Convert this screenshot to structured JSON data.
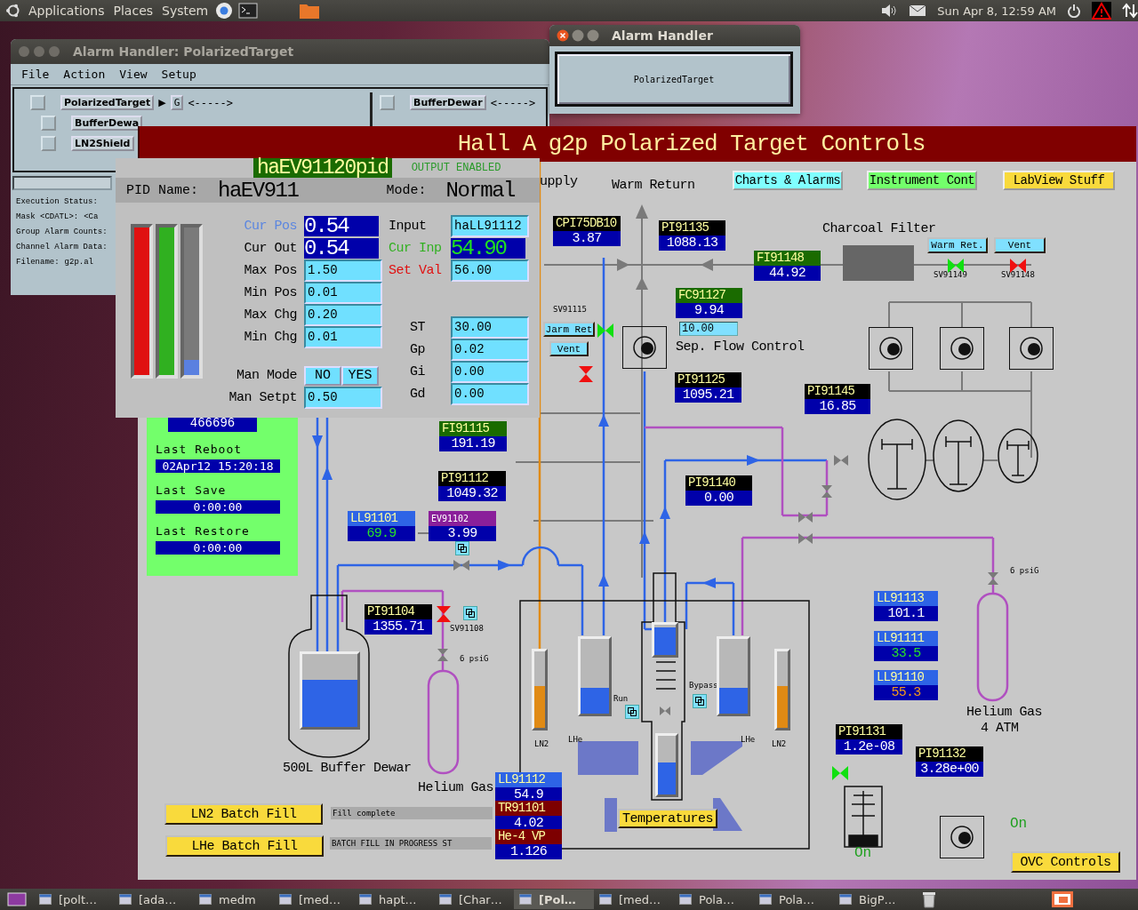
{
  "top_panel": {
    "menus": [
      "Applications",
      "Places",
      "System"
    ],
    "clock": "Sun Apr  8, 12:59 AM"
  },
  "alarm_window": {
    "title": "Alarm Handler: PolarizedTarget",
    "menus": [
      "File",
      "Action",
      "View",
      "Setup"
    ],
    "tree": {
      "label": "PolarizedTarget",
      "checked": false,
      "arrow": "▶",
      "group": "G",
      "count": "<----->",
      "children": [
        {
          "label": "BufferDewa",
          "checked": false
        },
        {
          "label": "LN2Shield",
          "checked": false
        }
      ]
    },
    "right_tree": [
      {
        "label": "BufferDewar",
        "checked": false,
        "count": "<----->"
      }
    ],
    "status": [
      {
        "label": "Execution Status:"
      },
      {
        "label": "Mask <CDATL>:",
        "value": "<Ca"
      },
      {
        "label": "Group Alarm Counts:"
      },
      {
        "label": "Channel Alarm Data:"
      },
      {
        "label": "Filename:",
        "value": "g2p.al"
      }
    ]
  },
  "small_alarm_window": {
    "title": "Alarm Handler",
    "button": "PolarizedTarget"
  },
  "main": {
    "title": "Hall A g2p Polarized Target Controls",
    "nav_buttons": [
      {
        "label": "Charts & Alarms",
        "color": "#80ffff"
      },
      {
        "label": "Instrument Cont",
        "color": "#73ff6b"
      },
      {
        "label": "LabView Stuff",
        "color": "#f9da3c"
      }
    ],
    "labels": [
      {
        "text": "upply"
      },
      {
        "text": "Warm Return"
      },
      {
        "text": "Charcoal Filter"
      },
      {
        "text": "Sep. Flow Control"
      },
      {
        "text": "500L Buffer Dewar"
      },
      {
        "text": "Helium Gas"
      },
      {
        "text": "Helium Gas"
      },
      {
        "text": "4 ATM"
      }
    ],
    "small_labels": [
      {
        "text": "SV91149"
      },
      {
        "text": "SV91148"
      },
      {
        "text": "SV91115"
      },
      {
        "text": "SV91108"
      },
      {
        "text": "6 psiG"
      },
      {
        "text": "6 psiG"
      },
      {
        "text": "LN2"
      },
      {
        "text": "LHe"
      },
      {
        "text": "LHe"
      },
      {
        "text": "LN2"
      },
      {
        "text": "Run"
      },
      {
        "text": "Bypass"
      }
    ],
    "readouts": [
      {
        "tag": "CPI75DB10",
        "value": "3.87",
        "color": "#000000",
        "in_range": false,
        "minor_alarm": false
      },
      {
        "tag": "PI91135",
        "value": "1088.13",
        "color": "#000000",
        "in_range": false,
        "minor_alarm": false
      },
      {
        "tag": "FI91148",
        "value": "44.92",
        "color": "#1a6b00",
        "in_range": false,
        "minor_alarm": false
      },
      {
        "tag": "FC91127",
        "value": "9.94",
        "color": "#1a6b00",
        "in_range": false,
        "minor_alarm": false
      },
      {
        "tag": "PI91125",
        "value": "1095.21",
        "color": "#000000",
        "in_range": false,
        "minor_alarm": false
      },
      {
        "tag": "PI91145",
        "value": "16.85",
        "color": "#000000",
        "in_range": false,
        "minor_alarm": false
      },
      {
        "tag": "FI91115",
        "value": "191.19",
        "color": "#1a6b00",
        "in_range": false,
        "minor_alarm": false
      },
      {
        "tag": "PI91112",
        "value": "1049.32",
        "color": "#000000",
        "in_range": false,
        "minor_alarm": false
      },
      {
        "tag": "PI91140",
        "value": "0.00",
        "color": "#000000",
        "in_range": false,
        "minor_alarm": false
      },
      {
        "tag": "LL91101",
        "value": "69.9",
        "color": "#2e64e6",
        "in_range": true,
        "minor_alarm": false
      },
      {
        "tag": "EV91102",
        "value": "3.99",
        "color": "#8a1f9a",
        "in_range": false,
        "minor_alarm": false
      },
      {
        "tag": "PI91104",
        "value": "1355.71",
        "color": "#000000",
        "in_range": false,
        "minor_alarm": false
      },
      {
        "tag": "LL91113",
        "value": "101.1",
        "color": "#2e64e6",
        "in_range": false,
        "minor_alarm": false
      },
      {
        "tag": "LL91111",
        "value": "33.5",
        "color": "#2e64e6",
        "in_range": true,
        "minor_alarm": false
      },
      {
        "tag": "LL91110",
        "value": "55.3",
        "color": "#2e64e6",
        "in_range": false,
        "minor_alarm": true
      },
      {
        "tag": "PI91131",
        "value": "1.2e-08",
        "color": "#000000",
        "in_range": false,
        "minor_alarm": false
      },
      {
        "tag": "PI91132",
        "value": "3.28e+00",
        "color": "#000000",
        "in_range": false,
        "minor_alarm": false
      },
      {
        "tag": "LL91112",
        "value": "54.9",
        "color": "#2e64e6",
        "in_range": false,
        "minor_alarm": false
      },
      {
        "tag": "TR91101",
        "value": "4.02",
        "color": "#7d0000",
        "in_range": false,
        "minor_alarm": false
      },
      {
        "tag": "He-4 VP",
        "value": "1.126",
        "color": "#7d0000",
        "in_range": false,
        "minor_alarm": false
      }
    ],
    "buttons": [
      {
        "label": "Warm Ret.",
        "color": "#80e0ff"
      },
      {
        "label": "Vent",
        "color": "#80e0ff"
      },
      {
        "label": "Jarm Ret",
        "color": "#80e0ff"
      },
      {
        "label": "Vent",
        "color": "#80e0ff"
      },
      {
        "label": "Temperatures",
        "color": "#f9da3c"
      },
      {
        "label": "LN2 Batch Fill",
        "color": "#f9da3c"
      },
      {
        "label": "LHe Batch Fill",
        "color": "#f9da3c"
      },
      {
        "label": "OVC Controls",
        "color": "#f9da3c"
      }
    ],
    "setpoint": {
      "value": "10.00"
    },
    "messages": [
      {
        "text": "Fill complete"
      },
      {
        "text": "BATCH FILL IN PROGRESS ST"
      }
    ],
    "indicators": [
      {
        "text": "On"
      },
      {
        "text": "On"
      }
    ],
    "valves": [
      {
        "open": true
      },
      {
        "open": false
      },
      {
        "open": true
      },
      {
        "open": false
      },
      {
        "open": false
      },
      {
        "open": true
      }
    ],
    "gauges": [
      {
        "level": 0.65,
        "color": "#2e64e6"
      },
      {
        "level": 0.55,
        "color": "#e08a14"
      },
      {
        "level": 0.35,
        "color": "#2e64e6"
      },
      {
        "level": 0.9,
        "color": "#2e64e6"
      },
      {
        "level": 0.55,
        "color": "#2e64e6"
      },
      {
        "level": 0.35,
        "color": "#2e64e6"
      },
      {
        "level": 0.55,
        "color": "#e08a14"
      }
    ],
    "info": {
      "counter": "466696",
      "rows": [
        {
          "label": "Last Reboot",
          "value": "02Apr12 15:20:18"
        },
        {
          "label": "Last Save",
          "value": "0:00:00"
        },
        {
          "label": "Last Restore",
          "value": "0:00:00"
        }
      ]
    }
  },
  "pid": {
    "title": "haEV91120pid",
    "status": "OUTPUT ENABLED",
    "name_label": "PID Name:",
    "name": "haEV911",
    "mode_label": "Mode:",
    "mode": "Normal",
    "bars": [
      {
        "color": "#e01010",
        "level": 1
      },
      {
        "color": "#30b020",
        "level": 1
      },
      {
        "color": "#5a80e0",
        "level": 0.1
      }
    ],
    "left": [
      {
        "label": "Cur Pos",
        "value": "0.54",
        "kind": "readout",
        "color": "#5b86e0",
        "in_range": false
      },
      {
        "label": "Cur Out",
        "value": "0.54",
        "kind": "readout",
        "color": "#000000",
        "in_range": false
      },
      {
        "label": "Max Pos",
        "value": "1.50",
        "kind": "entry",
        "color": "#000000"
      },
      {
        "label": "Min Pos",
        "value": "0.01",
        "kind": "entry",
        "color": "#000000"
      },
      {
        "label": "Max Chg",
        "value": "0.20",
        "kind": "entry",
        "color": "#000000"
      },
      {
        "label": "Min Chg",
        "value": "0.01",
        "kind": "entry",
        "color": "#000000"
      }
    ],
    "man_mode": {
      "label": "Man Mode",
      "options": [
        "NO",
        "YES"
      ]
    },
    "man_setpt": {
      "label": "Man Setpt",
      "value": "0.50"
    },
    "right": [
      {
        "label": "Input",
        "value": "haLL91112",
        "kind": "entry",
        "color": "#000000"
      },
      {
        "label": "Cur Inp",
        "value": "54.90",
        "kind": "readout",
        "color": "#30b020",
        "in_range": true
      },
      {
        "label": "Set Val",
        "value": "56.00",
        "kind": "entry",
        "color": "#e01010"
      }
    ],
    "gains": [
      {
        "label": "ST",
        "value": "30.00"
      },
      {
        "label": "Gp",
        "value": "0.02"
      },
      {
        "label": "Gi",
        "value": "0.00"
      },
      {
        "label": "Gd",
        "value": "0.00"
      }
    ]
  },
  "taskbar": [
    {
      "label": "[polt…",
      "selected": false
    },
    {
      "label": "[ada…",
      "selected": false
    },
    {
      "label": "medm",
      "selected": false
    },
    {
      "label": "[med…",
      "selected": false
    },
    {
      "label": "hapt…",
      "selected": false
    },
    {
      "label": "[Char…",
      "selected": false
    },
    {
      "label": "[Pol…",
      "selected": true
    },
    {
      "label": "[med…",
      "selected": false
    },
    {
      "label": "Pola…",
      "selected": false
    },
    {
      "label": "Pola…",
      "selected": false
    },
    {
      "label": "BigP…",
      "selected": false
    }
  ]
}
